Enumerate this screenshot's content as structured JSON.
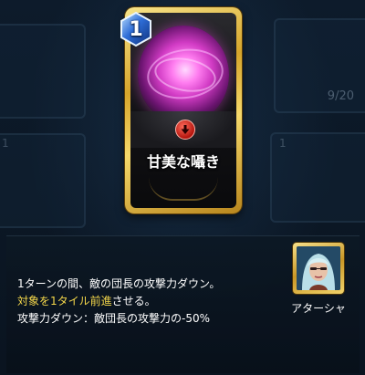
{
  "card": {
    "cost": "1",
    "name": "甘美な囁き",
    "effect_icon": "down-arrow-icon"
  },
  "background": {
    "counter": "9/20",
    "ghost_cost": "1"
  },
  "description": {
    "line1": "1ターンの間、敵の団長の攻撃力ダウン。",
    "line2_highlight": "対象を1タイル前進",
    "line2_rest": "させる。",
    "line3": "攻撃力ダウン：敵団長の攻撃力の-50%"
  },
  "character": {
    "name": "アターシャ"
  },
  "colors": {
    "highlight": "#f3d64a",
    "card_gold": "#d6a52b",
    "orb_pink": "#d13bc4",
    "cost_blue": "#2f6ed8"
  }
}
